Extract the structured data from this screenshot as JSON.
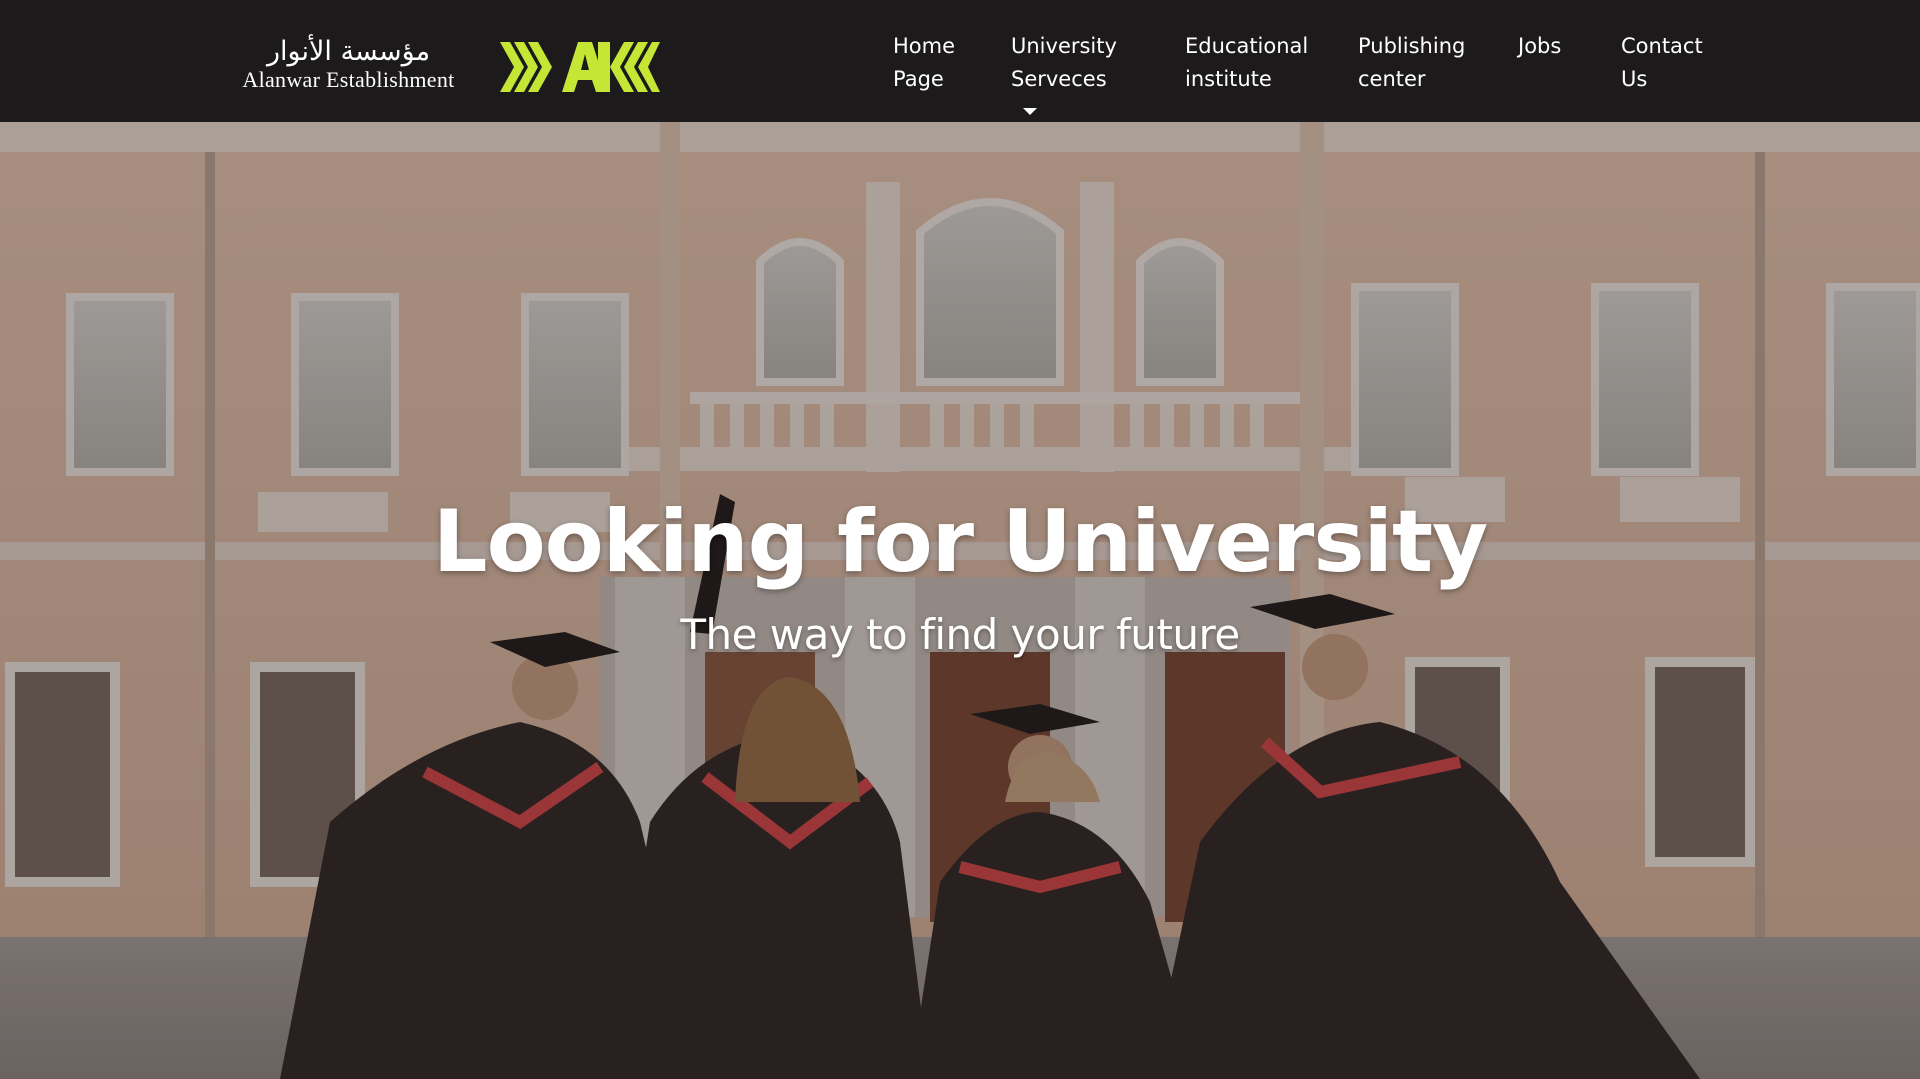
{
  "brand": {
    "arabic_name": "مؤسسة الأنوار",
    "latin_name": "Alanwar Establishment",
    "logo_icon": "alanwar-chevron-logo-icon",
    "logo_color": "#c5e635"
  },
  "nav": {
    "items": [
      {
        "label": "Home\nPage"
      },
      {
        "label": "University\nServeces",
        "dropdown": true
      },
      {
        "label": "Educational\ninstitute"
      },
      {
        "label": "Publishing\ncenter"
      },
      {
        "label": "Jobs"
      },
      {
        "label": "Contact Us"
      }
    ]
  },
  "hero": {
    "title": "Looking for University",
    "subtitle": "The way to find your future",
    "background": "university-building-graduates-photo"
  },
  "colors": {
    "navbar_bg": "#1d1a1b",
    "text": "#ffffff",
    "accent": "#c5e635",
    "gown_trim": "#d6474a"
  }
}
